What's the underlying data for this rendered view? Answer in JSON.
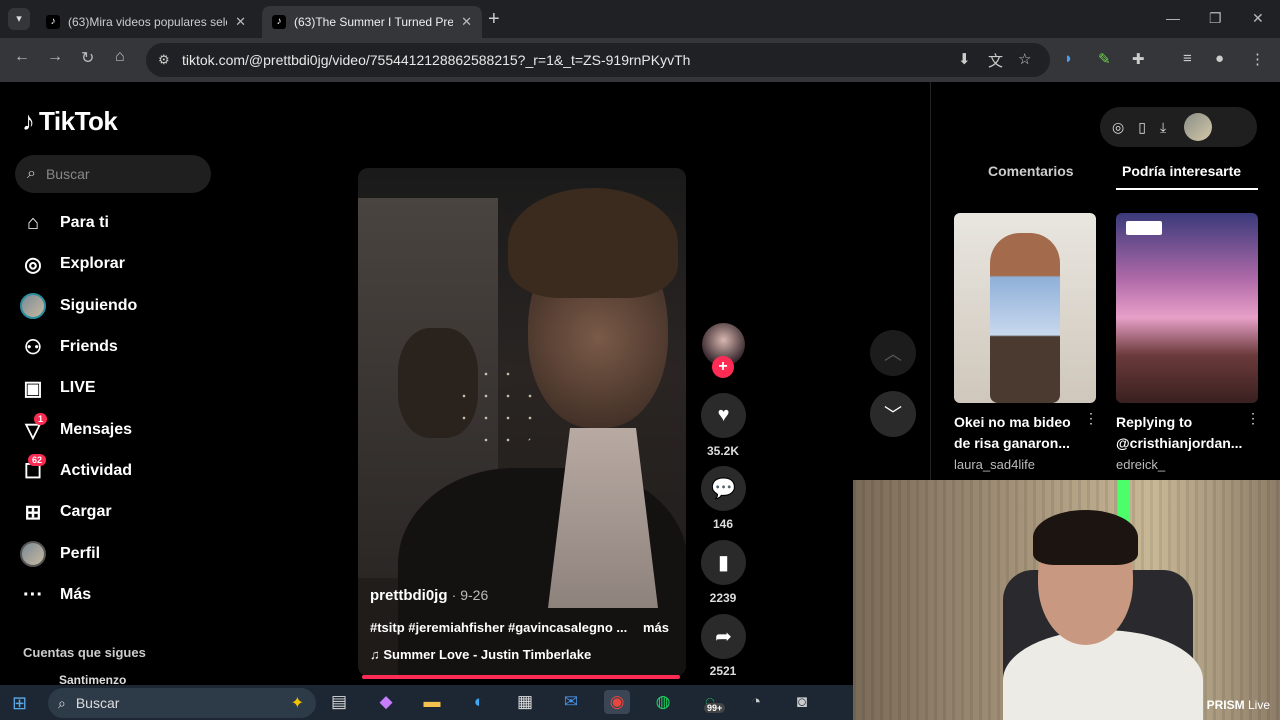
{
  "browser": {
    "tabs": [
      {
        "title": "(63)Mira videos populares selecci",
        "favicon": "tiktok-icon"
      },
      {
        "title": "(63)The Summer I Turned Pretty",
        "favicon": "tiktok-icon"
      }
    ],
    "url": "tiktok.com/@prettbdi0jg/video/7554412128862588215?_r=1&_t=ZS-919rnPKyvTh"
  },
  "sidebar": {
    "logo": "TikTok",
    "search_placeholder": "Buscar",
    "items": [
      {
        "label": "Para ti",
        "icon": "home-icon"
      },
      {
        "label": "Explorar",
        "icon": "compass-icon"
      },
      {
        "label": "Siguiendo",
        "icon": "following-avatar-icon"
      },
      {
        "label": "Friends",
        "icon": "friends-icon"
      },
      {
        "label": "LIVE",
        "icon": "live-icon"
      },
      {
        "label": "Mensajes",
        "icon": "inbox-icon",
        "badge": "1"
      },
      {
        "label": "Actividad",
        "icon": "activity-icon",
        "badge": "62"
      },
      {
        "label": "Cargar",
        "icon": "upload-icon"
      },
      {
        "label": "Perfil",
        "icon": "profile-avatar-icon"
      },
      {
        "label": "Más",
        "icon": "more-icon"
      }
    ],
    "section_title": "Cuentas que sigues",
    "followed": [
      "Santimenzo"
    ]
  },
  "video": {
    "username": "prettbdi0jg",
    "date": "· 9-26",
    "hashtags": "#tsitp #jeremiahfisher #gavincasalegno ...",
    "more": "más",
    "music": "Summer Love - Justin Timberlake",
    "progress": 1.0
  },
  "actions": {
    "likes": "35.2K",
    "comments": "146",
    "saves": "2239",
    "shares": "2521"
  },
  "right_panel": {
    "tabs": [
      "Comentarios",
      "Podría interesarte"
    ],
    "active_tab": "Podría interesarte",
    "recommendations": [
      {
        "title": "Okei no ma bideo de risa ganaron...",
        "author": "laura_sad4life"
      },
      {
        "title": "Replying to @cristhianjordan...",
        "author": "edreick_"
      }
    ]
  },
  "webcam": {
    "watermark_brand": "PRISM",
    "watermark_suffix": "Live"
  },
  "taskbar": {
    "search_placeholder": "Buscar",
    "whatsapp_badge": "99+"
  },
  "colors": {
    "accent": "#fe2c55",
    "background": "#000000"
  }
}
